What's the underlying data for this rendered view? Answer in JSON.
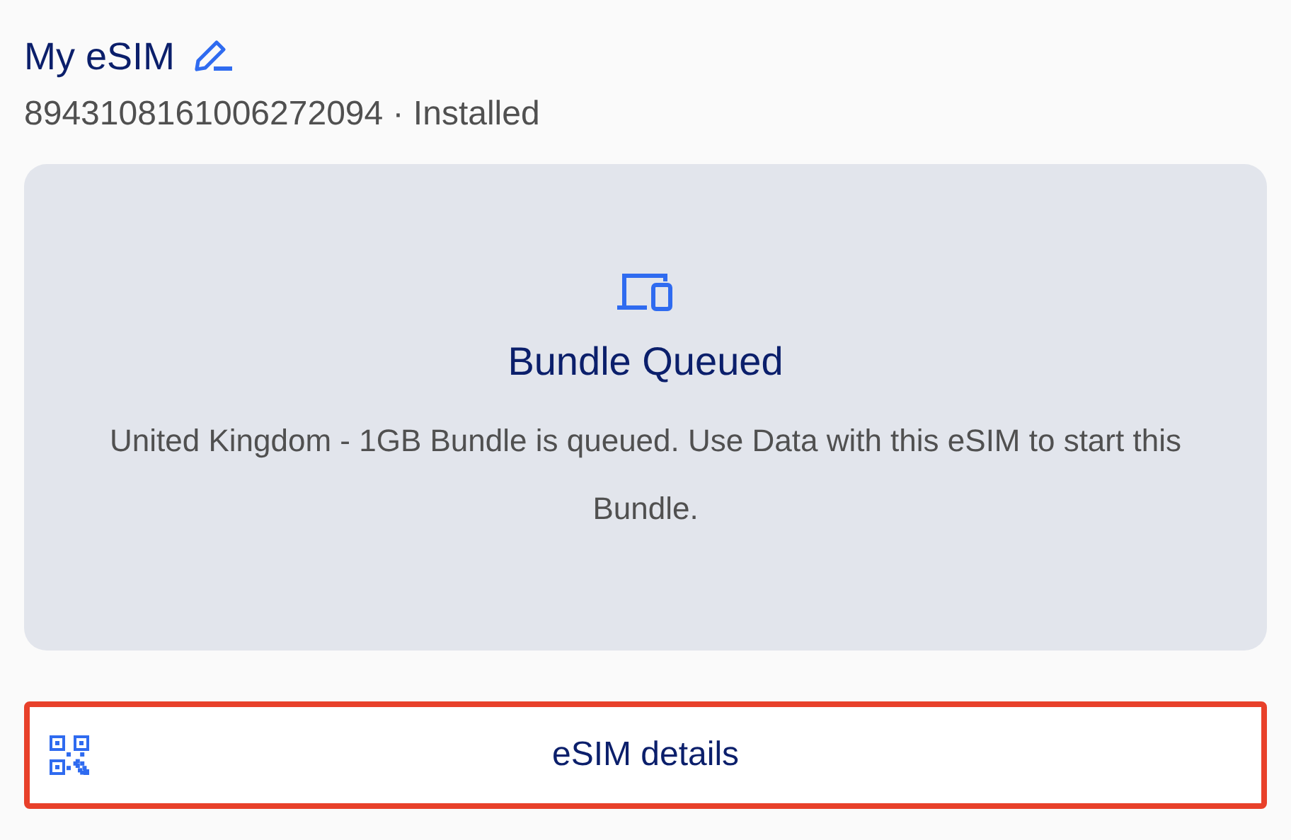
{
  "header": {
    "title": "My eSIM",
    "subtitle": "8943108161006272094 · Installed"
  },
  "status_card": {
    "title": "Bundle Queued",
    "message": "United Kingdom - 1GB Bundle is queued. Use Data with this eSIM to start this Bundle."
  },
  "details_button": {
    "label": "eSIM details",
    "highlighted": true
  }
}
